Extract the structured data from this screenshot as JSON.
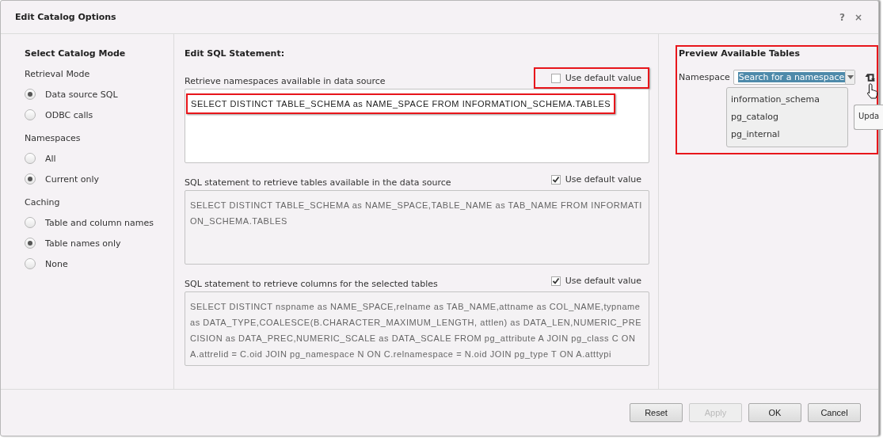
{
  "dialog": {
    "title": "Edit Catalog Options",
    "help": "?",
    "close": "×"
  },
  "catalog_mode": {
    "title": "Select Catalog Mode",
    "groups": [
      {
        "label": "Retrieval Mode",
        "options": [
          {
            "label": "Data source SQL",
            "selected": true
          },
          {
            "label": "ODBC calls",
            "selected": false
          }
        ]
      },
      {
        "label": "Namespaces",
        "options": [
          {
            "label": "All",
            "selected": false
          },
          {
            "label": "Current only",
            "selected": true
          }
        ]
      },
      {
        "label": "Caching",
        "options": [
          {
            "label": "Table and column names",
            "selected": false
          },
          {
            "label": "Table names only",
            "selected": true
          },
          {
            "label": "None",
            "selected": false
          }
        ]
      }
    ]
  },
  "sql": {
    "title": "Edit SQL Statement:",
    "statements": [
      {
        "label": "Retrieve namespaces available in data source",
        "default_label": "Use default value",
        "use_default": false,
        "highlighted": true,
        "value": "SELECT DISTINCT TABLE_SCHEMA as NAME_SPACE FROM INFORMATION_SCHEMA.TABLES"
      },
      {
        "label": "SQL statement to retrieve tables available in the data source",
        "default_label": "Use default value",
        "use_default": true,
        "highlighted": false,
        "value": "SELECT DISTINCT TABLE_SCHEMA as NAME_SPACE,TABLE_NAME as TAB_NAME FROM INFORMATION_SCHEMA.TABLES"
      },
      {
        "label": "SQL statement to retrieve columns for the selected tables",
        "default_label": "Use default value",
        "use_default": true,
        "highlighted": false,
        "value": "SELECT DISTINCT nspname as NAME_SPACE,relname as TAB_NAME,attname as COL_NAME,typname as DATA_TYPE,COALESCE(B.CHARACTER_MAXIMUM_LENGTH, attlen) as DATA_LEN,NUMERIC_PRECISION as DATA_PREC,NUMERIC_SCALE as DATA_SCALE FROM pg_attribute A JOIN pg_class C ON A.attrelid = C.oid JOIN pg_namespace N ON C.relnamespace = N.oid JOIN pg_type T ON A.atttypi"
      }
    ]
  },
  "preview": {
    "title": "Preview Available Tables",
    "highlighted": true,
    "namespace_label": "Namespace",
    "search": {
      "value": "Search for a namespace",
      "text_selected": true
    },
    "dropdown": [
      "information_schema",
      "pg_catalog",
      "pg_internal"
    ],
    "tooltip": "Upda"
  },
  "buttons": [
    {
      "label": "Reset",
      "disabled": false
    },
    {
      "label": "Apply",
      "disabled": true
    },
    {
      "label": "OK",
      "disabled": false
    },
    {
      "label": "Cancel",
      "disabled": false
    }
  ]
}
